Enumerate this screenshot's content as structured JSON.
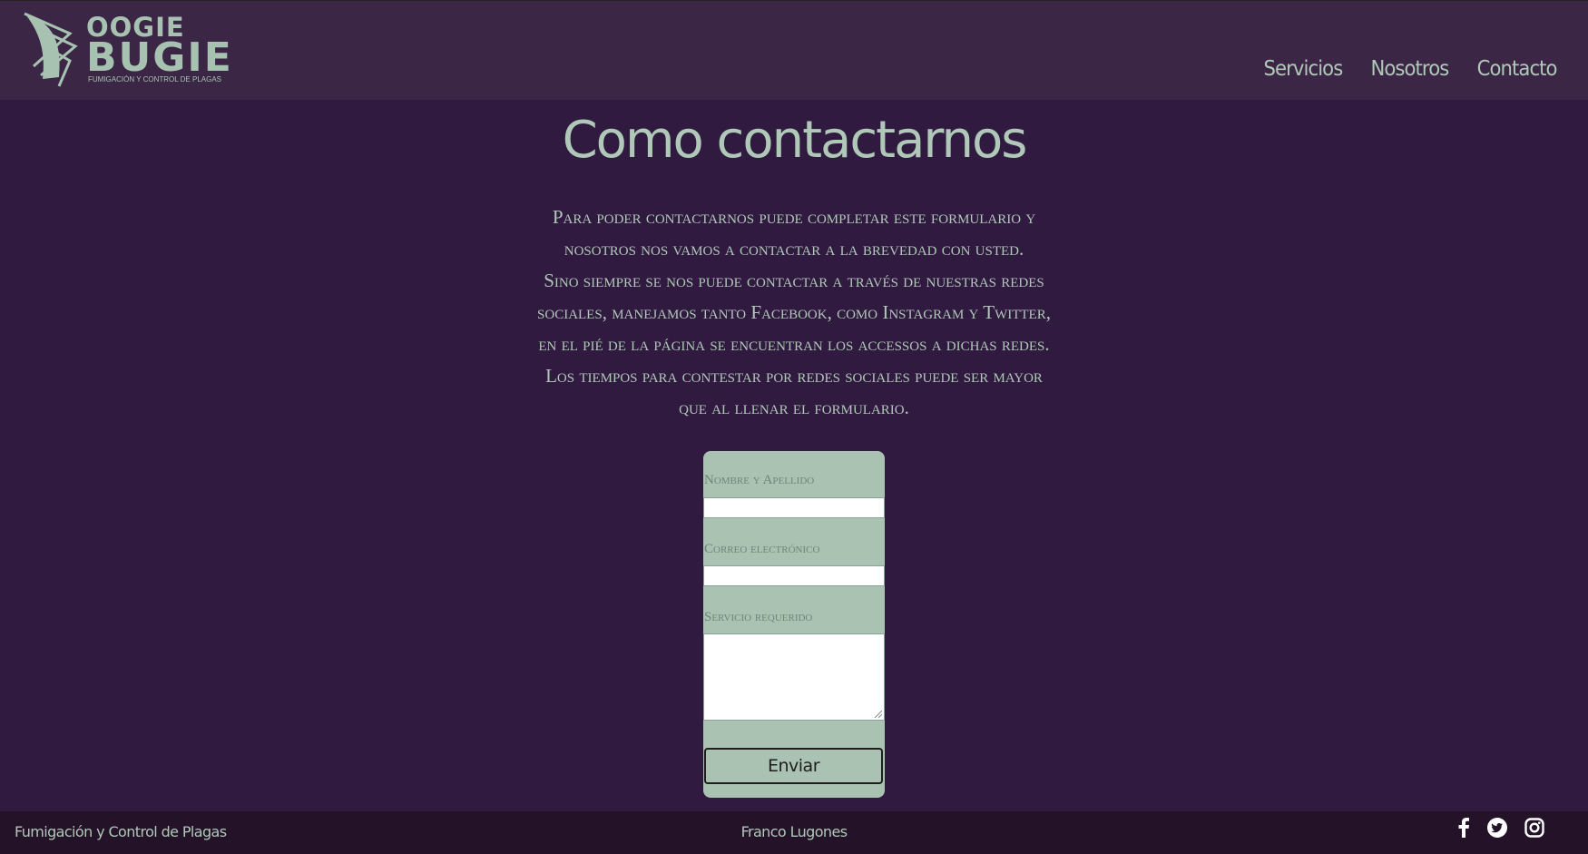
{
  "header": {
    "logo": {
      "line1": "OOGIE",
      "line2": "BUGIE",
      "tagline": "FUMIGACIÓN Y CONTROL DE PLAGAS"
    },
    "nav": [
      "Servicios",
      "Nosotros",
      "Contacto"
    ]
  },
  "main": {
    "title": "Como contactarnos",
    "paragraphs": [
      "Para poder contactarnos puede completar este formulario y nosotros nos vamos a contactar a la brevedad con usted.",
      "Sino siempre se nos puede contactar a través de nuestras redes sociales, manejamos tanto Facebook, como Instagram y Twitter, en el pié de la página se encuentran los accessos a dichas redes.",
      "Los tiempos para contestar por redes sociales puede ser mayor que al llenar el formulario."
    ]
  },
  "form": {
    "name_label": "Nombre y Apellido",
    "name_value": "",
    "email_label": "Correo electrónico",
    "email_value": "",
    "service_label": "Servicio requerido",
    "service_value": "",
    "submit_label": "Enviar"
  },
  "footer": {
    "left": "Fumigación y Control de Plagas",
    "center": "Franco Lugones",
    "socials": [
      "facebook-icon",
      "twitter-icon",
      "instagram-icon"
    ]
  },
  "colors": {
    "header_bg": "#3b2745",
    "page_bg": "#311a40",
    "footer_bg": "#241328",
    "accent": "#afc8b8",
    "form_bg": "#a9c2b1"
  }
}
